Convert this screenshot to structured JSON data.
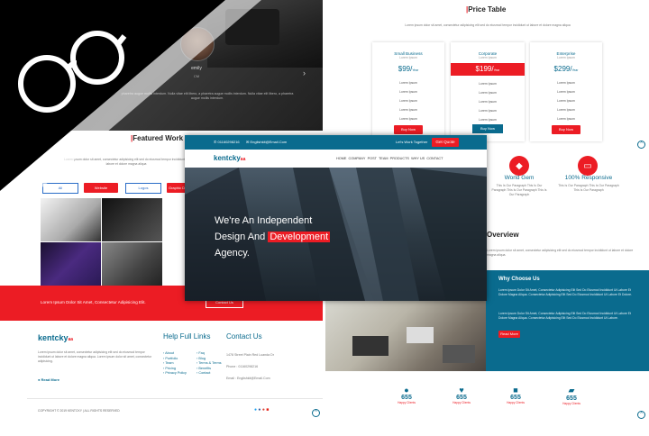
{
  "brand": {
    "name": "kentcky",
    "suffix": "aa",
    "accent": "#ec1c24",
    "teal": "#0a6b8e",
    "dark": "#111111"
  },
  "testimonial": {
    "name": "emily",
    "role": "CM",
    "text": "pharetra augue mollis interdum. Nulla vitae elit libero, a pharetra augue mollis interdum. Nulla vitae elit libero, a pharetra augue mollis interdum."
  },
  "featured": {
    "title_bar": "|",
    "title": "Featured Work",
    "filters": [
      "All",
      "Website",
      "Logos",
      "Graphic D"
    ],
    "intro": "Lorem ipsum dolor sit amet, consectetur adipisicing elit sed do eiusmod tempor incididunt ut labore et dolore magna aliqua"
  },
  "banner": {
    "text": "Lorem Ipsum Dolor Sit Amet, Consectetur Adipisicing Elit.",
    "button": "Contact Us"
  },
  "price_table": {
    "title": "Price Table",
    "intro": "Lorem ipsum dolor sit amet, consectetur adipisicing elit sed do eiusmod tempor incididunt ut labore et dolore magna aliqua",
    "plans": [
      {
        "name": "Small Business",
        "sub": "Lorem Ipsum",
        "price": "$99/",
        "period": "Year",
        "features": [
          "Lorem Ipsum",
          "Lorem Ipsum",
          "Lorem Ipsum",
          "Lorem Ipsum",
          "Lorem Ipsum"
        ],
        "button": "Buy Now"
      },
      {
        "name": "Corporate",
        "sub": "Lorem Ipsum",
        "price": "$199/",
        "period": "Year",
        "features": [
          "Lorem Ipsum",
          "Lorem Ipsum",
          "Lorem Ipsum",
          "Lorem Ipsum",
          "Lorem Ipsum"
        ],
        "button": "Buy Now"
      },
      {
        "name": "Enterprise",
        "sub": "Lorem Ipsum",
        "price": "$299/",
        "period": "Year",
        "features": [
          "Lorem Ipsum",
          "Lorem Ipsum",
          "Lorem Ipsum",
          "Lorem Ipsum",
          "Lorem Ipsum"
        ],
        "button": "Buy Now"
      }
    ]
  },
  "features": [
    {
      "title": "World Gem",
      "text": "This Is Our Paragraph This Is Our Paragraph This Is Our Paragraph This Is Our Paragraph"
    },
    {
      "title": "100% Responsive",
      "text": "This Is Our Paragraph This Is Our Paragraph This Is Our Paragraph"
    }
  ],
  "overview": {
    "title": "Overview",
    "text": "Lorem ipsum dolor sit amet, consectetur adipisicing elit sed do eiusmod tempor incididunt ut labore et dolore magna aliqua."
  },
  "why": {
    "title": "Why Choose Us",
    "p1": "Lorem Ipsum Dolor Sit Amet, Consectetur Adipisicing Elit Sed Do Eiusmod Incididunt Ut Labore Et Dolore Magna Aliqua. Consectetur Adipisicing Elit Sed Do Eiusmod Incididunt Ut Labore Et Dolore.",
    "p2": "Lorem Ipsum Dolor Sit Amet, Consectetur Adipisicing Elit Sed Do Eiusmod Incididunt Ut Labore Et Dolore Magna Aliqua. Consectetur Adipisicing Elit Sed Do Eiusmod Incididunt Ut Labore.",
    "button": "Read More"
  },
  "stats": [
    {
      "icon": "user-icon",
      "value": "655",
      "label": "Happy Clients"
    },
    {
      "icon": "heart-icon",
      "value": "655",
      "label": "Happy Clients"
    },
    {
      "icon": "briefcase-icon",
      "value": "655",
      "label": "Happy Clients"
    },
    {
      "icon": "comments-icon",
      "value": "655",
      "label": "Happy Clients"
    }
  ],
  "footer": {
    "about": "Lorem ipsum dolor sit amet, consectetur adipisicing elit sed do eiusmod tempor incididunt ut labore et dolore magna aliqua. Lorem ipsum dolor sit amet, consectetur adipisicing.",
    "read_more": "Read More",
    "links_title": "Help Full Links",
    "links_col1": [
      "About",
      "Portfolio",
      "Team",
      "Pricing",
      "Privacy Policy"
    ],
    "links_col2": [
      "Faq",
      "Blog",
      "Terms & Terms",
      "Benefits",
      "Contact"
    ],
    "contact_title": "Contact Us",
    "address": "1478 Street Plain Red Luanda Dr",
    "phone": "Phone : 01160298216",
    "email": "Email : Englishkit@Email.Com",
    "copyright": "COPYRIGHT © 2019 KENTCKY | ALL RIGHTS RESERVED"
  },
  "hero": {
    "topbar_phone": "01160298216",
    "topbar_email": "Englishkit@Email.Com",
    "topbar_cta_text": "Let's Work Together",
    "topbar_cta_button": "Get Quote",
    "nav": [
      "HOME",
      "COMPANY",
      "POST",
      "TEAM",
      "PRODUCTS",
      "WHY US",
      "CONTACT"
    ],
    "headline_1": "We're An Independent",
    "headline_2a": "Design And ",
    "headline_2b": "Development",
    "headline_3": "Agency."
  }
}
